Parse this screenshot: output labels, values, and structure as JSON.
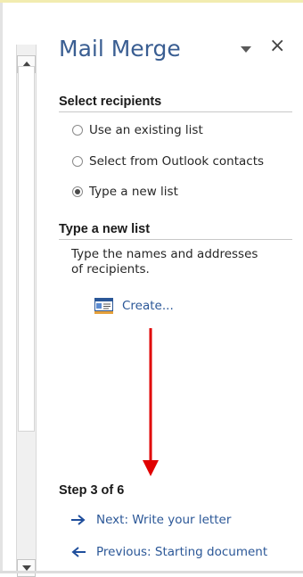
{
  "pane": {
    "title": "Mail Merge",
    "close_glyph": "×"
  },
  "select_recipients": {
    "header": "Select recipients",
    "options": [
      {
        "label": "Use an existing list",
        "checked": false
      },
      {
        "label": "Select from Outlook contacts",
        "checked": false
      },
      {
        "label": "Type a new list",
        "checked": true
      }
    ]
  },
  "type_new_list": {
    "header": "Type a new list",
    "description": "Type the names and addresses of recipients.",
    "create_link": "Create...",
    "create_icon": "address-list-icon"
  },
  "steps": {
    "label": "Step 3 of 6",
    "next": "Next: Write your letter",
    "previous": "Previous: Starting document"
  },
  "colors": {
    "title": "#3a5e92",
    "link": "#2b5797",
    "annotation_arrow": "#e00000",
    "nav_arrow": "#1f4e9c"
  }
}
